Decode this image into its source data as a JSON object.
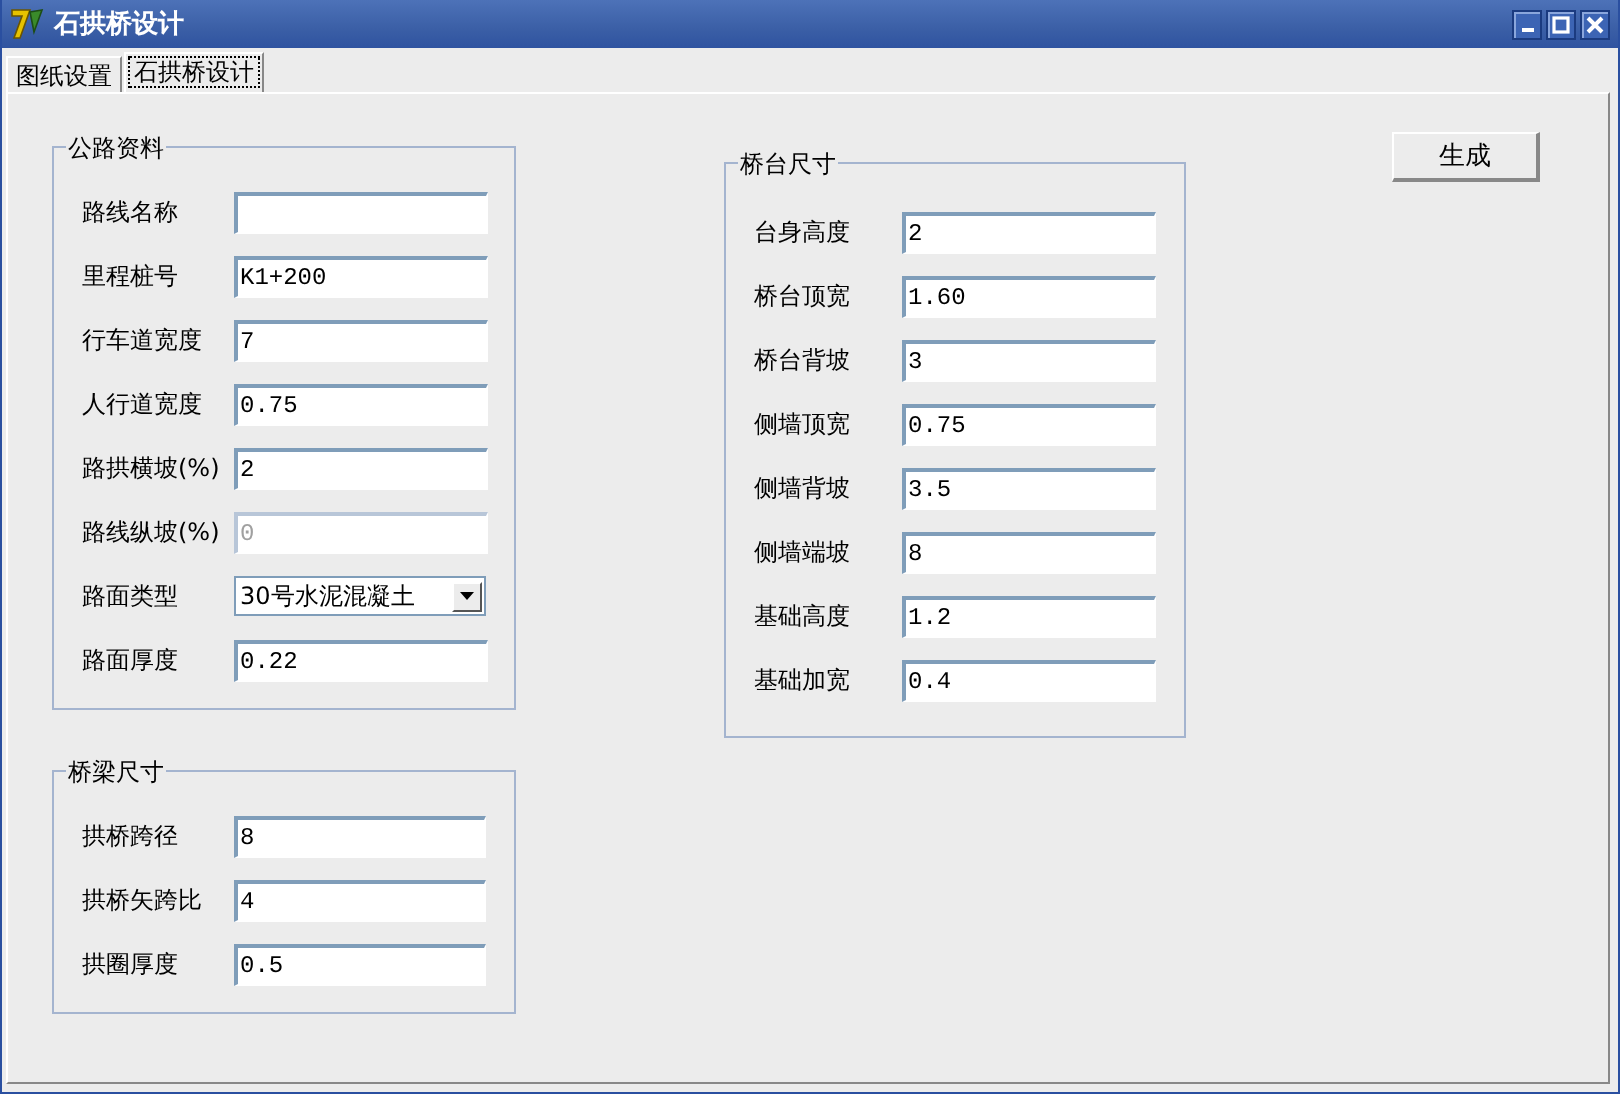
{
  "window": {
    "title": "石拱桥设计"
  },
  "tabs": [
    {
      "label": "图纸设置",
      "selected": false
    },
    {
      "label": "石拱桥设计",
      "selected": true
    }
  ],
  "groups": [
    {
      "title": "公路资料",
      "fields": [
        {
          "label": "路线名称",
          "kind": "text",
          "disabled": false
        },
        {
          "label": "里程桩号",
          "kind": "text",
          "value": "K1+200",
          "disabled": false
        },
        {
          "label": "行车道宽度",
          "kind": "text",
          "value": "7",
          "disabled": false
        },
        {
          "label": "人行道宽度",
          "kind": "text",
          "value": "0.75",
          "disabled": false
        },
        {
          "label": "路拱横坡(%)",
          "kind": "text",
          "value": "2",
          "disabled": false
        },
        {
          "label": "路线纵坡(%)",
          "kind": "text",
          "value": "0",
          "disabled": true
        },
        {
          "label": "路面类型",
          "kind": "select",
          "value": "30号水泥混凝土",
          "disabled": false
        },
        {
          "label": "路面厚度",
          "kind": "text",
          "value": "0.22",
          "disabled": false
        }
      ]
    },
    {
      "title": "桥梁尺寸",
      "fields": [
        {
          "label": "拱桥跨径",
          "kind": "text",
          "value": "8",
          "disabled": false
        },
        {
          "label": "拱桥矢跨比",
          "kind": "text",
          "value": "4",
          "disabled": false
        },
        {
          "label": "拱圈厚度",
          "kind": "text",
          "value": "0.5",
          "disabled": false
        }
      ]
    },
    {
      "title": "桥台尺寸",
      "fields": [
        {
          "label": "台身高度",
          "kind": "text",
          "value": "2",
          "disabled": false
        },
        {
          "label": "桥台顶宽",
          "kind": "text",
          "value": "1.60",
          "disabled": false
        },
        {
          "label": "桥台背坡",
          "kind": "text",
          "value": "3",
          "disabled": false
        },
        {
          "label": "侧墙顶宽",
          "kind": "text",
          "value": "0.75",
          "disabled": false
        },
        {
          "label": "侧墙背坡",
          "kind": "text",
          "value": "3.5",
          "disabled": false
        },
        {
          "label": "侧墙端坡",
          "kind": "text",
          "value": "8",
          "disabled": false
        },
        {
          "label": "基础高度",
          "kind": "text",
          "value": "1.2",
          "disabled": false
        },
        {
          "label": "基础加宽",
          "kind": "text",
          "value": "0.4",
          "disabled": false
        }
      ]
    }
  ],
  "buttons": [
    {
      "label": "生成"
    }
  ]
}
